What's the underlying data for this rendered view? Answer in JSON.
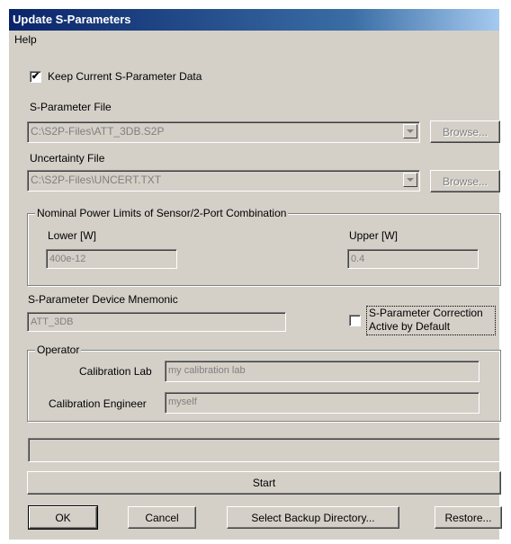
{
  "window": {
    "title": "Update S-Parameters"
  },
  "menu": {
    "help": "Help"
  },
  "keep_current": {
    "label": "Keep Current S-Parameter Data",
    "checked_glyph": "✔"
  },
  "sparam_file": {
    "label": "S-Parameter File",
    "value": "C:\\S2P-Files\\ATT_3DB.S2P",
    "browse": "Browse..."
  },
  "uncertainty_file": {
    "label": "Uncertainty File",
    "value": "C:\\S2P-Files\\UNCERT.TXT",
    "browse": "Browse..."
  },
  "power_limits": {
    "legend": "Nominal Power Limits of Sensor/2-Port Combination",
    "lower_label": "Lower [W]",
    "lower_value": "400e-12",
    "upper_label": "Upper [W]",
    "upper_value": "0.4"
  },
  "mnemonic": {
    "label": "S-Parameter Device Mnemonic",
    "value": "ATT_3DB"
  },
  "correction": {
    "line1": "S-Parameter Correction",
    "line2": "Active by Default",
    "checked": false
  },
  "operator": {
    "legend": "Operator",
    "lab_label": "Calibration Lab",
    "lab_value": "my calibration lab",
    "engineer_label": "Calibration Engineer",
    "engineer_value": "myself"
  },
  "progress": {
    "value": 0
  },
  "buttons": {
    "start": "Start",
    "ok": "OK",
    "cancel": "Cancel",
    "backup": "Select Backup Directory...",
    "restore": "Restore..."
  }
}
